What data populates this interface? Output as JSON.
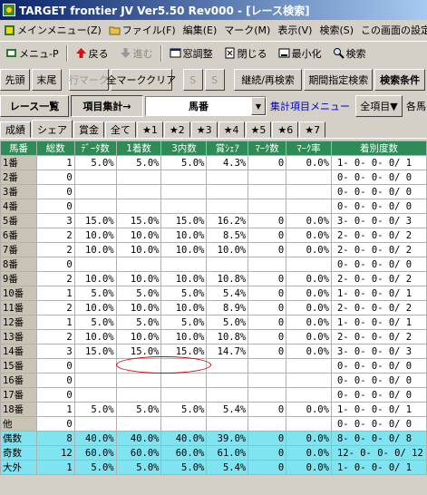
{
  "window": {
    "title": "TARGET frontier JV  Ver5.50  Rev000 - [レース検索]"
  },
  "menu": [
    "メインメニュー(Z)",
    "ファイル(F)",
    "編集(E)",
    "マーク(M)",
    "表示(V)",
    "検索(S)",
    "この画面の設定(O)"
  ],
  "toolbar": {
    "menu_p": "メニュ-P",
    "back": "戻る",
    "forward": "進む",
    "window_adjust": "窓調整",
    "close": "閉じる",
    "minimize": "最小化",
    "search": "検索"
  },
  "buttons": {
    "first": "先頭",
    "last": "末尾",
    "row_mark": "行マーク",
    "clear_all_marks": "全マーククリア",
    "s1": "S",
    "s2": "S",
    "continue_search": "継続/再検索",
    "period_search": "期間指定検索",
    "search_conditions": "検索条件"
  },
  "row4": {
    "race_list": "レース一覧",
    "aggregate": "項目集計→",
    "field_value": "馬番",
    "aggregate_menu": "集計項目メニュー",
    "all_items": "全項目▼",
    "each": "各馬"
  },
  "tabs": [
    "成績",
    "シェア",
    "賞金",
    "全て",
    "★1",
    "★2",
    "★3",
    "★4",
    "★5",
    "★6",
    "★7"
  ],
  "selected_tab": 1,
  "table": {
    "headers": [
      "馬番",
      "総数",
      "ﾃﾞｰﾀ数",
      "1着数",
      "3内数",
      "賞ｼｪｱ",
      "ﾏｰｸ数",
      "ﾏｰｸ率",
      "着別度数"
    ],
    "rows": [
      {
        "label": "1番",
        "cells": [
          "1",
          "5.0%",
          "5.0%",
          "5.0%",
          "4.3%",
          "0",
          "0.0%",
          "1- 0- 0- 0/ 1"
        ]
      },
      {
        "label": "2番",
        "cells": [
          "0",
          "",
          "",
          "",
          "",
          "",
          "",
          "0- 0- 0- 0/ 0"
        ]
      },
      {
        "label": "3番",
        "cells": [
          "0",
          "",
          "",
          "",
          "",
          "",
          "",
          "0- 0- 0- 0/ 0"
        ]
      },
      {
        "label": "4番",
        "cells": [
          "0",
          "",
          "",
          "",
          "",
          "",
          "",
          "0- 0- 0- 0/ 0"
        ]
      },
      {
        "label": "5番",
        "cells": [
          "3",
          "15.0%",
          "15.0%",
          "15.0%",
          "16.2%",
          "0",
          "0.0%",
          "3- 0- 0- 0/ 3"
        ]
      },
      {
        "label": "6番",
        "cells": [
          "2",
          "10.0%",
          "10.0%",
          "10.0%",
          "8.5%",
          "0",
          "0.0%",
          "2- 0- 0- 0/ 2"
        ]
      },
      {
        "label": "7番",
        "cells": [
          "2",
          "10.0%",
          "10.0%",
          "10.0%",
          "10.0%",
          "0",
          "0.0%",
          "2- 0- 0- 0/ 2"
        ]
      },
      {
        "label": "8番",
        "cells": [
          "0",
          "",
          "",
          "",
          "",
          "",
          "",
          "0- 0- 0- 0/ 0"
        ]
      },
      {
        "label": "9番",
        "cells": [
          "2",
          "10.0%",
          "10.0%",
          "10.0%",
          "10.8%",
          "0",
          "0.0%",
          "2- 0- 0- 0/ 2"
        ]
      },
      {
        "label": "10番",
        "cells": [
          "1",
          "5.0%",
          "5.0%",
          "5.0%",
          "5.4%",
          "0",
          "0.0%",
          "1- 0- 0- 0/ 1"
        ]
      },
      {
        "label": "11番",
        "cells": [
          "2",
          "10.0%",
          "10.0%",
          "10.0%",
          "8.9%",
          "0",
          "0.0%",
          "2- 0- 0- 0/ 2"
        ]
      },
      {
        "label": "12番",
        "cells": [
          "1",
          "5.0%",
          "5.0%",
          "5.0%",
          "5.0%",
          "0",
          "0.0%",
          "1- 0- 0- 0/ 1"
        ]
      },
      {
        "label": "13番",
        "cells": [
          "2",
          "10.0%",
          "10.0%",
          "10.0%",
          "10.8%",
          "0",
          "0.0%",
          "2- 0- 0- 0/ 2"
        ]
      },
      {
        "label": "14番",
        "cells": [
          "3",
          "15.0%",
          "15.0%",
          "15.0%",
          "14.7%",
          "0",
          "0.0%",
          "3- 0- 0- 0/ 3"
        ]
      },
      {
        "label": "15番",
        "cells": [
          "0",
          "",
          "",
          "",
          "",
          "",
          "",
          "0- 0- 0- 0/ 0"
        ]
      },
      {
        "label": "16番",
        "cells": [
          "0",
          "",
          "",
          "",
          "",
          "",
          "",
          "0- 0- 0- 0/ 0"
        ]
      },
      {
        "label": "17番",
        "cells": [
          "0",
          "",
          "",
          "",
          "",
          "",
          "",
          "0- 0- 0- 0/ 0"
        ]
      },
      {
        "label": "18番",
        "cells": [
          "1",
          "5.0%",
          "5.0%",
          "5.0%",
          "5.4%",
          "0",
          "0.0%",
          "1- 0- 0- 0/ 1"
        ]
      },
      {
        "label": "他",
        "cells": [
          "0",
          "",
          "",
          "",
          "",
          "",
          "",
          "0- 0- 0- 0/ 0"
        ]
      },
      {
        "label": "偶数",
        "cells": [
          "8",
          "40.0%",
          "40.0%",
          "40.0%",
          "39.0%",
          "0",
          "0.0%",
          "8- 0- 0- 0/ 8"
        ],
        "highlight": true
      },
      {
        "label": "奇数",
        "cells": [
          "12",
          "60.0%",
          "60.0%",
          "60.0%",
          "61.0%",
          "0",
          "0.0%",
          "12- 0- 0- 0/ 12"
        ],
        "highlight": true
      },
      {
        "label": "大外",
        "cells": [
          "1",
          "5.0%",
          "5.0%",
          "5.0%",
          "5.4%",
          "0",
          "0.0%",
          "1- 0- 0- 0/ 1"
        ],
        "highlight": true
      }
    ]
  },
  "colors": {
    "header_bg": "#2e8b57",
    "highlight_bg": "#7fe3f0",
    "annotation": "#d00000"
  }
}
